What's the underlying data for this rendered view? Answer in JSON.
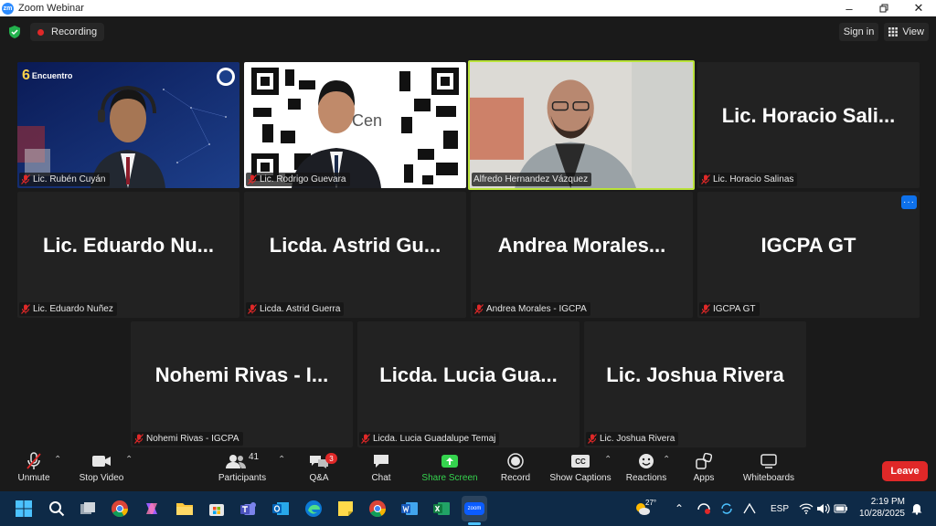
{
  "window": {
    "app_icon_text": "zm",
    "title": "Zoom Webinar"
  },
  "topbar": {
    "recording_label": "Recording",
    "sign_in_label": "Sign in",
    "view_label": "View"
  },
  "tiles": [
    {
      "name": "Lic. Rubén Cuyán",
      "type": "video"
    },
    {
      "name": "Lic. Rodrigo Guevara",
      "type": "video"
    },
    {
      "name": "Alfredo Hernandez Vázquez",
      "type": "video",
      "active_speaker": true
    },
    {
      "name": "Lic. Horacio Salinas",
      "display": "Lic.  Horacio  Sali..."
    },
    {
      "name": "Lic. Eduardo Nuñez",
      "display": "Lic.  Eduardo  Nu..."
    },
    {
      "name": "Licda. Astrid Guerra",
      "display": "Licda.  Astrid  Gu..."
    },
    {
      "name": "Andrea Morales - IGCPA",
      "display": "Andrea  Morales..."
    },
    {
      "name": "IGCPA GT",
      "display": "IGCPA GT"
    },
    {
      "name": "Nohemi Rivas - IGCPA",
      "display": "Nohemi  Rivas  -  I..."
    },
    {
      "name": "Licda. Lucia Guadalupe Temaj",
      "display": "Licda.  Lucia  Gua..."
    },
    {
      "name": "Lic. Joshua Rivera",
      "display": "Lic.  Joshua  Rivera"
    }
  ],
  "video_text": {
    "logo_text": "Encuentro",
    "logo_num": "6",
    "slide_text": "Cen"
  },
  "tile_menu_label": "···",
  "toolbar": {
    "unmute": "Unmute",
    "stop_video": "Stop Video",
    "participants": "Participants",
    "participants_count": "41",
    "qa": "Q&A",
    "qa_badge": "3",
    "chat": "Chat",
    "share_screen": "Share Screen",
    "record": "Record",
    "captions": "Show Captions",
    "captions_icon": "CC",
    "reactions": "Reactions",
    "apps": "Apps",
    "whiteboards": "Whiteboards",
    "leave": "Leave"
  },
  "taskbar": {
    "weather": "27°",
    "zoom_label": "zoom",
    "language": "ESP",
    "time": "2:19 PM",
    "date": "10/28/2025"
  },
  "colors": {
    "active_border": "#b9e23a",
    "leave": "#e02828",
    "share": "#35d34e",
    "accent": "#0e71eb"
  }
}
